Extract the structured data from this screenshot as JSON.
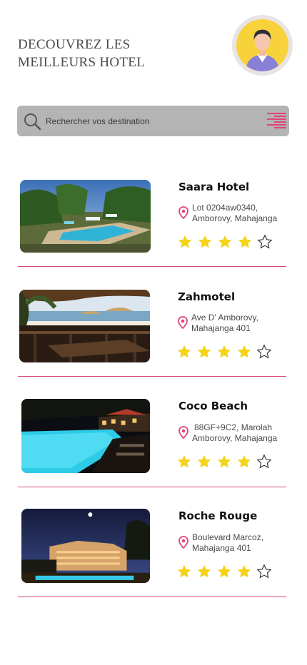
{
  "header": {
    "title_line1": "DECOUVREZ LES",
    "title_line2": "MEILLEURS HOTEL"
  },
  "search": {
    "placeholder": "Rechercher vos destination",
    "value": ""
  },
  "hotels": [
    {
      "name": "Saara Hotel",
      "address_line1": "Lot 0204aw0340,",
      "address_line2": "Amborovy, Mahajanga",
      "rating": 4,
      "rating_max": 5
    },
    {
      "name": "Zahmotel",
      "address_line1": "Ave D' Amborovy,",
      "address_line2": "Mahajanga 401",
      "rating": 4,
      "rating_max": 5
    },
    {
      "name": "Coco Beach",
      "address_line1": "88GF+9C2, Marolah",
      "address_line2": "Amborovy, Mahajanga",
      "rating": 4,
      "rating_max": 5
    },
    {
      "name": "Roche Rouge",
      "address_line1": "Boulevard Marcoz,",
      "address_line2": "Mahajanga 401",
      "rating": 4,
      "rating_max": 5
    }
  ],
  "colors": {
    "accent": "#e0457a",
    "star_filled": "#f5d316",
    "search_bg": "#b4b4b4",
    "avatar_bg": "#f7d23a"
  },
  "icons": {
    "avatar": "user-avatar-icon",
    "search": "search-icon",
    "filter": "filter-list-icon",
    "location": "location-pin-icon",
    "star": "star-icon"
  }
}
